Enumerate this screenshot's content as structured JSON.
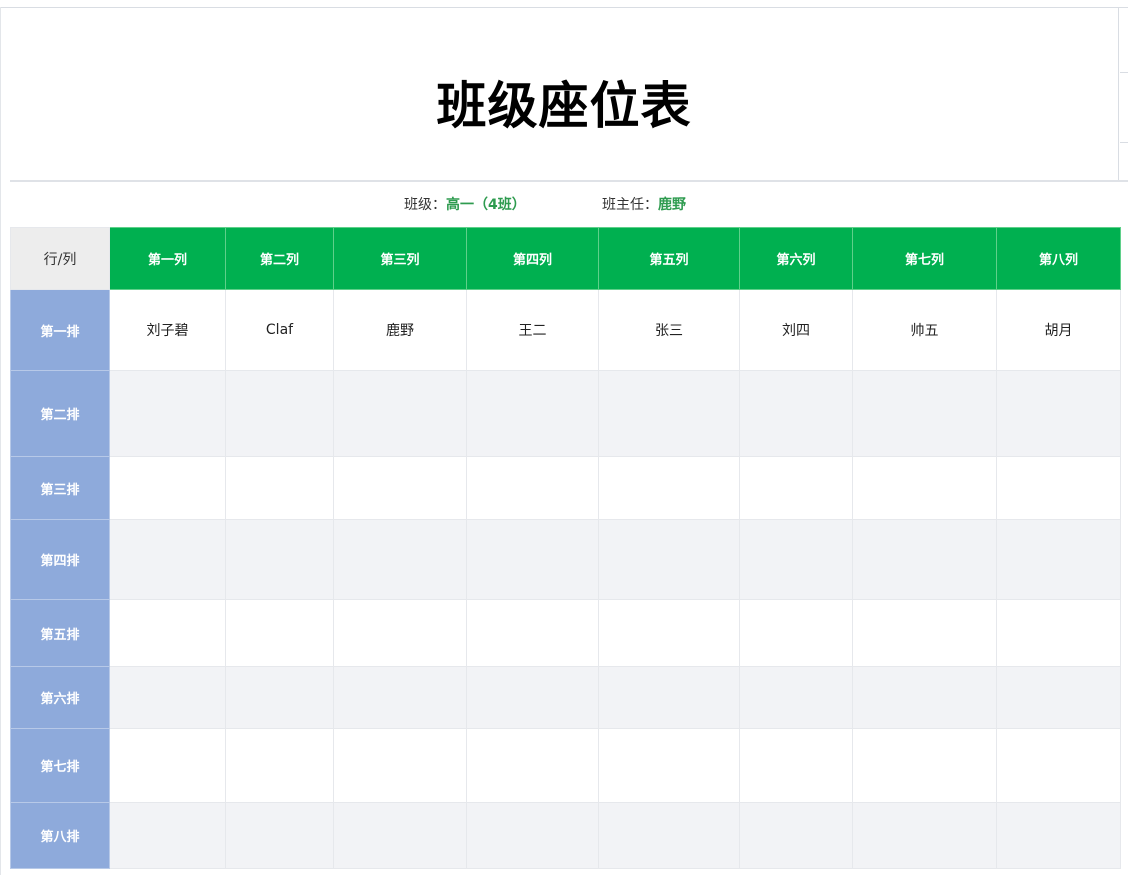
{
  "title": "班级座位表",
  "info": {
    "class_label": "班级：",
    "class_value": "高一（4班）",
    "teacher_label": "班主任：",
    "teacher_value": "鹿野"
  },
  "table": {
    "corner": "行/列",
    "columns": [
      "第一列",
      "第二列",
      "第三列",
      "第四列",
      "第五列",
      "第六列",
      "第七列",
      "第八列"
    ],
    "rows": [
      {
        "label": "第一排",
        "cells": [
          "刘子碧",
          "Claf",
          "鹿野",
          "王二",
          "张三",
          "刘四",
          "帅五",
          "胡月"
        ]
      },
      {
        "label": "第二排",
        "cells": [
          "",
          "",
          "",
          "",
          "",
          "",
          "",
          ""
        ]
      },
      {
        "label": "第三排",
        "cells": [
          "",
          "",
          "",
          "",
          "",
          "",
          "",
          ""
        ]
      },
      {
        "label": "第四排",
        "cells": [
          "",
          "",
          "",
          "",
          "",
          "",
          "",
          ""
        ]
      },
      {
        "label": "第五排",
        "cells": [
          "",
          "",
          "",
          "",
          "",
          "",
          "",
          ""
        ]
      },
      {
        "label": "第六排",
        "cells": [
          "",
          "",
          "",
          "",
          "",
          "",
          "",
          ""
        ]
      },
      {
        "label": "第七排",
        "cells": [
          "",
          "",
          "",
          "",
          "",
          "",
          "",
          ""
        ]
      },
      {
        "label": "第八排",
        "cells": [
          "",
          "",
          "",
          "",
          "",
          "",
          "",
          ""
        ]
      }
    ]
  },
  "colors": {
    "header_green": "#00b050",
    "row_header_blue": "#8eaadb",
    "value_green": "#2e9b4f"
  }
}
